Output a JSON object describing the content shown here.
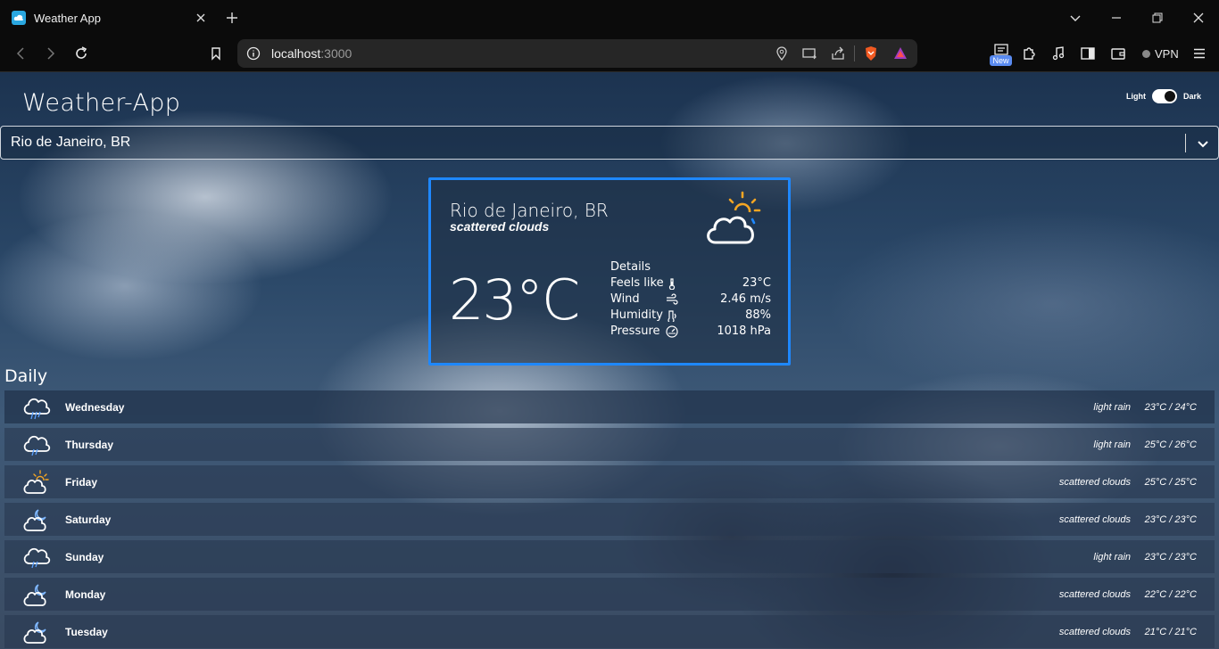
{
  "browser": {
    "tab_title": "Weather App",
    "url_host": "localhost",
    "url_port": ":3000",
    "new_badge": "New",
    "vpn_label": "VPN",
    "icons": [
      "back-icon",
      "forward-icon",
      "reload-icon",
      "bookmark-icon",
      "info-icon",
      "location-icon",
      "cast-icon",
      "share-icon",
      "brave-shield-icon",
      "brave-rewards-icon",
      "extensions-icon",
      "media-icon",
      "sidebar-icon",
      "wallet-icon",
      "menu-icon"
    ]
  },
  "app": {
    "title": "Weather-App",
    "theme": {
      "light_label": "Light",
      "dark_label": "Dark",
      "selected": "dark"
    },
    "search": {
      "value": "Rio de Janeiro, BR"
    }
  },
  "current": {
    "city": "Rio de Janeiro, BR",
    "description": "scattered clouds",
    "temperature": "23°C",
    "icon": "partly-cloudy-sun-icon",
    "details_title": "Details",
    "details": [
      {
        "label": "Feels like",
        "icon": "thermometer-icon",
        "value": "23°C"
      },
      {
        "label": "Wind",
        "icon": "wind-icon",
        "value": "2.46 m/s"
      },
      {
        "label": "Humidity",
        "icon": "humidity-icon",
        "value": "88%"
      },
      {
        "label": "Pressure",
        "icon": "pressure-icon",
        "value": "1018 hPa"
      }
    ]
  },
  "daily": {
    "title": "Daily",
    "days": [
      {
        "day": "Wednesday",
        "description": "light rain",
        "range": "23°C / 24°C",
        "icon": "rain-cloud-icon"
      },
      {
        "day": "Thursday",
        "description": "light rain",
        "range": "25°C / 26°C",
        "icon": "rain-cloud-icon"
      },
      {
        "day": "Friday",
        "description": "scattered clouds",
        "range": "25°C / 25°C",
        "icon": "partly-cloudy-sun-icon"
      },
      {
        "day": "Saturday",
        "description": "scattered clouds",
        "range": "23°C / 23°C",
        "icon": "partly-cloudy-night-icon"
      },
      {
        "day": "Sunday",
        "description": "light rain",
        "range": "23°C / 23°C",
        "icon": "rain-cloud-icon"
      },
      {
        "day": "Monday",
        "description": "scattered clouds",
        "range": "22°C / 22°C",
        "icon": "partly-cloudy-night-icon"
      },
      {
        "day": "Tuesday",
        "description": "scattered clouds",
        "range": "21°C / 21°C",
        "icon": "partly-cloudy-night-icon"
      }
    ]
  },
  "colors": {
    "accent": "#1e88ff",
    "sun": "#f5a623"
  }
}
